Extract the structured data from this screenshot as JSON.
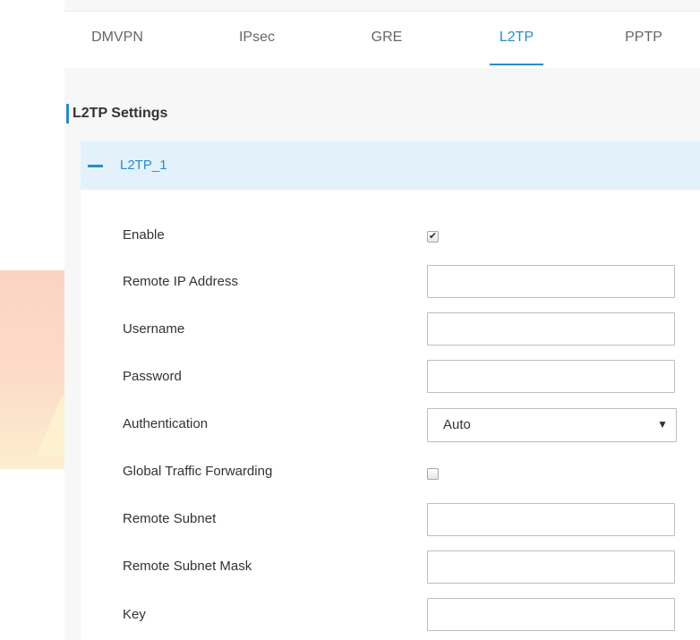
{
  "tabs": [
    {
      "label": "DMVPN",
      "active": false
    },
    {
      "label": "IPsec",
      "active": false
    },
    {
      "label": "GRE",
      "active": false
    },
    {
      "label": "L2TP",
      "active": true
    },
    {
      "label": "PPTP",
      "active": false
    }
  ],
  "section": {
    "title": "L2TP Settings"
  },
  "group": {
    "title": "L2TP_1",
    "expanded": true
  },
  "form": {
    "enable": {
      "label": "Enable",
      "checked": true
    },
    "remote_ip": {
      "label": "Remote IP Address",
      "value": ""
    },
    "username": {
      "label": "Username",
      "value": ""
    },
    "password": {
      "label": "Password",
      "value": ""
    },
    "authentication": {
      "label": "Authentication",
      "value": "Auto"
    },
    "global_forwarding": {
      "label": "Global Traffic Forwarding",
      "checked": false
    },
    "remote_subnet": {
      "label": "Remote Subnet",
      "value": ""
    },
    "remote_subnet_mask": {
      "label": "Remote Subnet Mask",
      "value": ""
    },
    "key": {
      "label": "Key",
      "value": ""
    }
  },
  "colors": {
    "accent": "#2b8cc4",
    "group_header_bg": "#e3f1fb",
    "page_bg": "#f7f7f7"
  }
}
